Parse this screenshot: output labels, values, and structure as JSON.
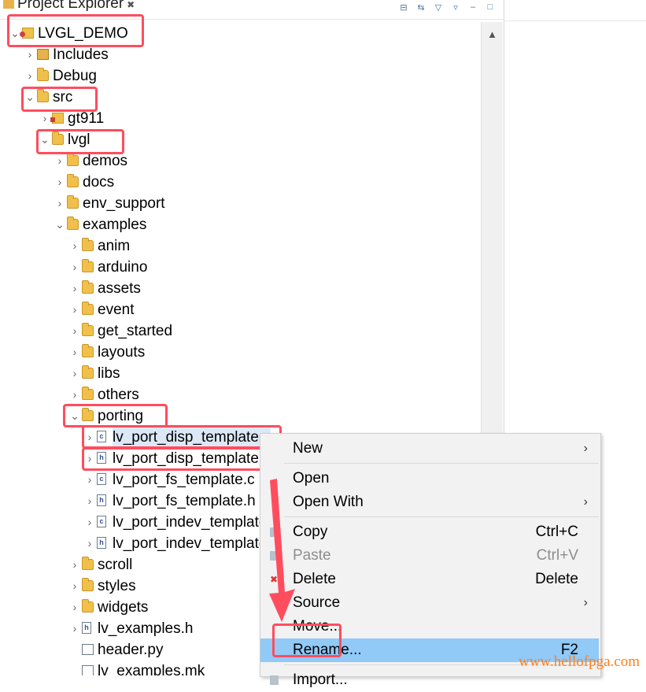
{
  "explorer": {
    "title": "Project Explorer",
    "close": "✖"
  },
  "toolbar": {
    "collapse": "⊟",
    "link": "⇆",
    "filter": "▽",
    "menu": "▿",
    "minimize": "–",
    "maximize": "□"
  },
  "tree": [
    {
      "label": "LVGL_DEMO",
      "depth": 0,
      "expanded": true,
      "icon": "project-icon"
    },
    {
      "label": "Includes",
      "depth": 1,
      "expanded": false,
      "icon": "includes-icon"
    },
    {
      "label": "Debug",
      "depth": 1,
      "expanded": false,
      "icon": "folder-icon"
    },
    {
      "label": "src",
      "depth": 1,
      "expanded": true,
      "icon": "folder-icon"
    },
    {
      "label": "gt911",
      "depth": 2,
      "expanded": false,
      "icon": "source-folder-icon"
    },
    {
      "label": "lvgl",
      "depth": 2,
      "expanded": true,
      "icon": "folder-icon"
    },
    {
      "label": "demos",
      "depth": 3,
      "expanded": false,
      "icon": "folder-icon"
    },
    {
      "label": "docs",
      "depth": 3,
      "expanded": false,
      "icon": "folder-icon"
    },
    {
      "label": "env_support",
      "depth": 3,
      "expanded": false,
      "icon": "folder-icon"
    },
    {
      "label": "examples",
      "depth": 3,
      "expanded": true,
      "icon": "folder-icon"
    },
    {
      "label": "anim",
      "depth": 4,
      "expanded": false,
      "icon": "folder-icon"
    },
    {
      "label": "arduino",
      "depth": 4,
      "expanded": false,
      "icon": "folder-icon"
    },
    {
      "label": "assets",
      "depth": 4,
      "expanded": false,
      "icon": "folder-icon"
    },
    {
      "label": "event",
      "depth": 4,
      "expanded": false,
      "icon": "folder-icon"
    },
    {
      "label": "get_started",
      "depth": 4,
      "expanded": false,
      "icon": "folder-icon"
    },
    {
      "label": "layouts",
      "depth": 4,
      "expanded": false,
      "icon": "folder-icon"
    },
    {
      "label": "libs",
      "depth": 4,
      "expanded": false,
      "icon": "folder-icon"
    },
    {
      "label": "others",
      "depth": 4,
      "expanded": false,
      "icon": "folder-icon"
    },
    {
      "label": "porting",
      "depth": 4,
      "expanded": true,
      "icon": "folder-icon"
    },
    {
      "label": "lv_port_disp_template.c",
      "depth": 5,
      "expanded": false,
      "icon": "c-file-icon",
      "selected": true
    },
    {
      "label": "lv_port_disp_template.h",
      "depth": 5,
      "expanded": false,
      "icon": "h-file-icon"
    },
    {
      "label": "lv_port_fs_template.c",
      "depth": 5,
      "expanded": false,
      "icon": "c-file-icon"
    },
    {
      "label": "lv_port_fs_template.h",
      "depth": 5,
      "expanded": false,
      "icon": "h-file-icon"
    },
    {
      "label": "lv_port_indev_template.c",
      "depth": 5,
      "expanded": false,
      "icon": "c-file-icon"
    },
    {
      "label": "lv_port_indev_template.h",
      "depth": 5,
      "expanded": false,
      "icon": "h-file-icon"
    },
    {
      "label": "scroll",
      "depth": 4,
      "expanded": false,
      "icon": "folder-icon"
    },
    {
      "label": "styles",
      "depth": 4,
      "expanded": false,
      "icon": "folder-icon"
    },
    {
      "label": "widgets",
      "depth": 4,
      "expanded": false,
      "icon": "folder-icon"
    },
    {
      "label": "lv_examples.h",
      "depth": 4,
      "expanded": false,
      "icon": "h-file-icon"
    },
    {
      "label": "header.py",
      "depth": 4,
      "leaf": true,
      "icon": "py-file-icon"
    },
    {
      "label": "lv_examples.mk",
      "depth": 4,
      "leaf": true,
      "icon": "mk-file-icon"
    }
  ],
  "context_menu": {
    "items": [
      {
        "label": "New",
        "submenu": true
      },
      {
        "separator": true
      },
      {
        "label": "Open"
      },
      {
        "label": "Open With",
        "submenu": true
      },
      {
        "separator": true
      },
      {
        "label": "Copy",
        "shortcut": "Ctrl+C",
        "icon": "copy-icon"
      },
      {
        "label": "Paste",
        "shortcut": "Ctrl+V",
        "disabled": true,
        "icon": "paste-icon"
      },
      {
        "label": "Delete",
        "shortcut": "Delete",
        "icon": "delete-icon"
      },
      {
        "label": "Source",
        "submenu": true
      },
      {
        "label": "Move..."
      },
      {
        "label": "Rename...",
        "shortcut": "F2",
        "active": true
      },
      {
        "separator": true
      },
      {
        "label": "Import...",
        "icon": "import-icon"
      }
    ]
  },
  "watermark": "www.hellofpga.com",
  "colors": {
    "highlight": "#ff4d5e",
    "menu_active": "#91c9f7",
    "watermark": "#ff7f1a"
  }
}
